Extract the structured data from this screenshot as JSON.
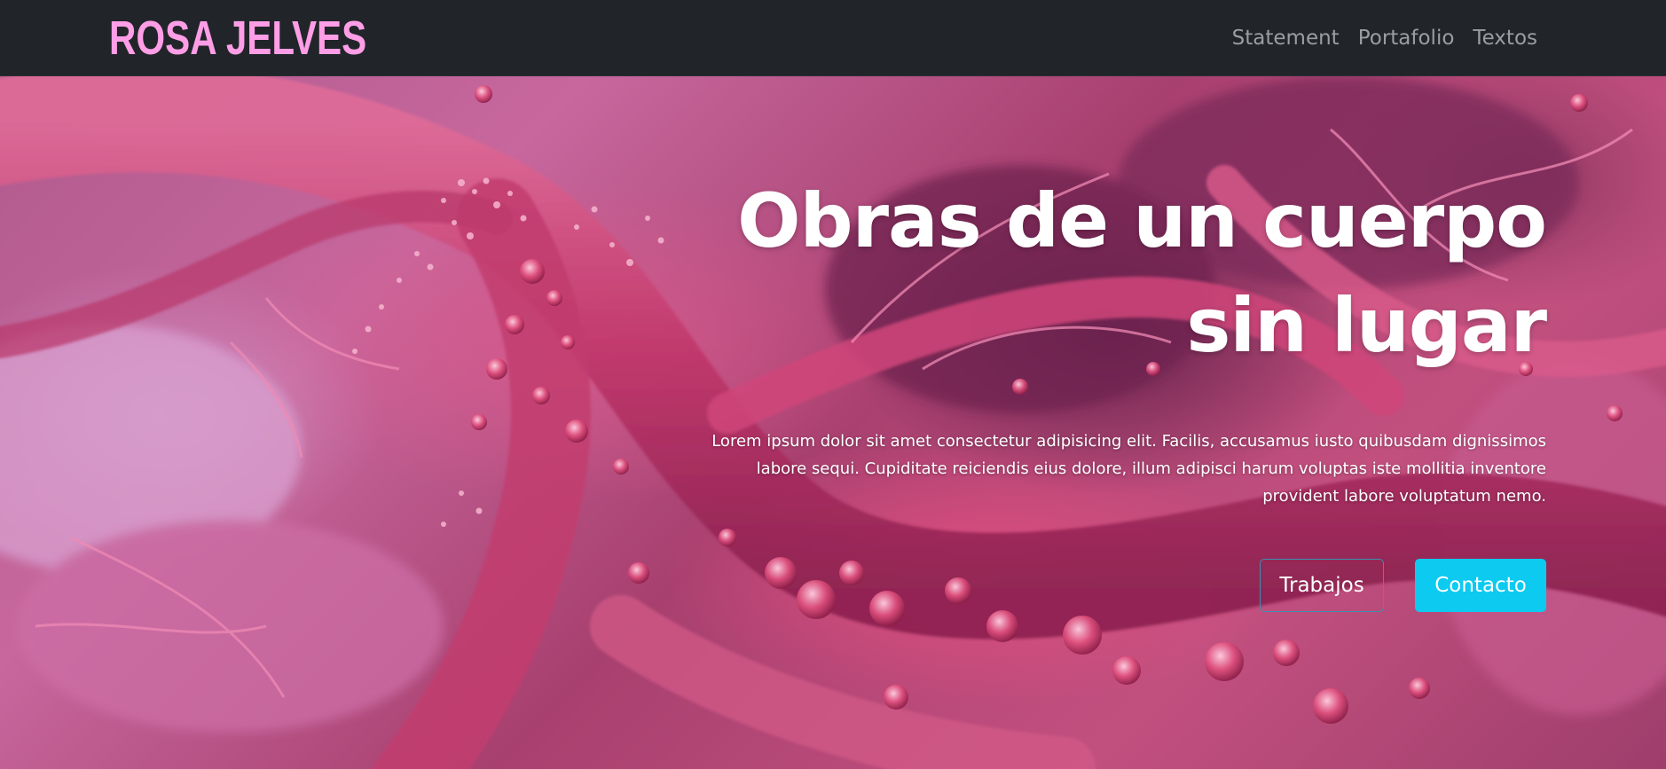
{
  "navbar": {
    "brand": "ROSA JELVES",
    "links": [
      "Statement",
      "Portafolio",
      "Textos"
    ]
  },
  "hero": {
    "title_line1": "Obras de un cuerpo",
    "title_line2": "sin lugar",
    "lead": "Lorem ipsum dolor sit amet consectetur adipisicing elit. Facilis, accusamus iusto quibusdam dignissimos labore sequi. Cupiditate reiciendis eius dolore, illum adipisci harum voluptas iste mollitia inventore provident labore voluptatum nemo.",
    "primary_button": "Trabajos",
    "secondary_button": "Contacto"
  },
  "colors": {
    "navbar_bg": "#212529",
    "brand": "#ff9ee6",
    "nav_link": "#9a9da1",
    "button_accent": "#0dcaf0",
    "hero_tint": "#c2507f"
  }
}
